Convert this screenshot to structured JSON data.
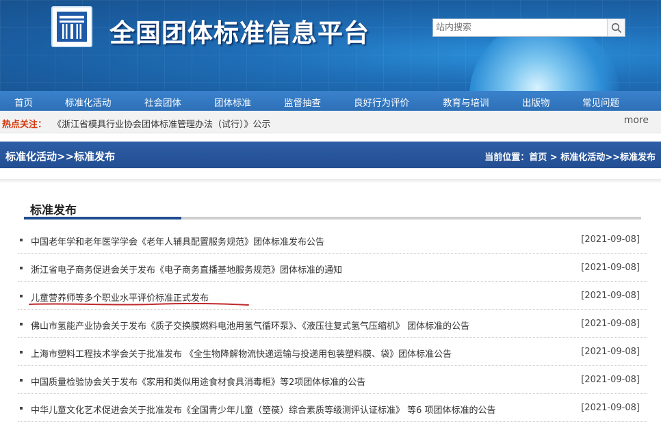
{
  "header": {
    "site_title": "全国团体标准信息平台",
    "search_placeholder": "站内搜索",
    "search_icon": "search-icon",
    "logo_icon": "platform-logo"
  },
  "nav": {
    "items": [
      "首页",
      "标准化活动",
      "社会团体",
      "团体标准",
      "监督抽查",
      "良好行为评价",
      "教育与培训",
      "出版物",
      "常见问题"
    ]
  },
  "hot": {
    "label": "热点关注：",
    "text": "《浙江省模具行业协会团体标准管理办法（试行）》公示",
    "more": "more"
  },
  "section": {
    "left": "标准化活动>>标准发布",
    "right": "当前位置：首页 > 标准化活动>>标准发布"
  },
  "content": {
    "heading": "标准发布",
    "items": [
      {
        "title": "中国老年学和老年医学学会《老年人辅具配置服务规范》团体标准发布公告",
        "date": "[2021-09-08]"
      },
      {
        "title": "浙江省电子商务促进会关于发布《电子商务直播基地服务规范》团体标准的通知",
        "date": "[2021-09-08]"
      },
      {
        "title": "儿童营养师等多个职业水平评价标准正式发布",
        "date": "[2021-09-08]"
      },
      {
        "title": "佛山市氢能产业协会关于发布《质子交换膜燃料电池用氢气循环泵》、《液压往复式氢气压缩机》 团体标准的公告",
        "date": "[2021-09-08]"
      },
      {
        "title": "上海市塑料工程技术学会关于批准发布 《全生物降解物流快递运输与投递用包装塑料膜、袋》团体标准公告",
        "date": "[2021-09-08]"
      },
      {
        "title": "中国质量检验协会关于发布《家用和类似用途食材食具消毒柜》等2项团体标准的公告",
        "date": "[2021-09-08]"
      },
      {
        "title": "中华儿童文化艺术促进会关于批准发布《全国青少年儿童（箜篌）综合素质等级测评认证标准》 等6 项团体标准的公告",
        "date": "[2021-09-08]"
      }
    ],
    "accent_color": "#1f4d8f",
    "highlight_color": "#c0282c"
  }
}
